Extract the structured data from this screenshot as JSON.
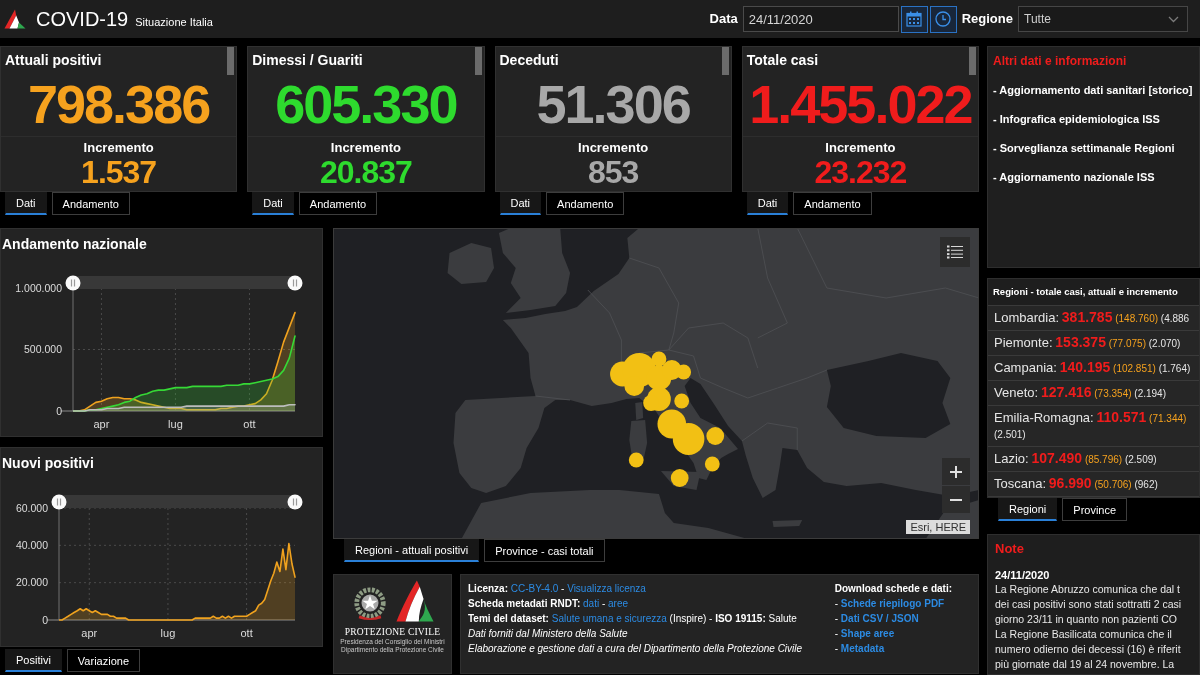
{
  "header": {
    "title": "COVID-19",
    "subtitle": "Situazione Italia",
    "date_label": "Data",
    "date_field": {
      "value": "24/11/2020"
    },
    "region_label": "Regione",
    "region_select": {
      "value": "Tutte"
    }
  },
  "summary_cards": [
    {
      "title": "Attuali positivi",
      "value": "798.386",
      "increment_label": "Incremento",
      "increment": "1.537",
      "color": "#f6a21e",
      "tabs": [
        {
          "label": "Dati",
          "selected": true
        },
        {
          "label": "Andamento",
          "selected": false
        }
      ]
    },
    {
      "title": "Dimessi / Guariti",
      "value": "605.330",
      "increment_label": "Incremento",
      "increment": "20.837",
      "color": "#2edb2e",
      "tabs": [
        {
          "label": "Dati",
          "selected": true
        },
        {
          "label": "Andamento",
          "selected": false
        }
      ]
    },
    {
      "title": "Deceduti",
      "value": "51.306",
      "increment_label": "Incremento",
      "increment": "853",
      "color": "#a8a8a8",
      "tabs": [
        {
          "label": "Dati",
          "selected": true
        },
        {
          "label": "Andamento",
          "selected": false
        }
      ]
    },
    {
      "title": "Totale casi",
      "value": "1.455.022",
      "increment_label": "Incremento",
      "increment": "23.232",
      "color": "#f01c1c",
      "tabs": [
        {
          "label": "Dati",
          "selected": true
        },
        {
          "label": "Andamento",
          "selected": false
        }
      ]
    }
  ],
  "other_info": {
    "title": "Altri dati e informazioni",
    "links": [
      "- Aggiornamento dati sanitari [storico]",
      "- Infografica epidemiologica ISS",
      "- Sorveglianza settimanale Regioni",
      "- Aggiornamento nazionale ISS"
    ]
  },
  "charts": [
    {
      "title": "Andamento nazionale",
      "range_slider": {
        "start": {
          "level": 0
        },
        "end": {
          "level": 1
        }
      },
      "chart_data": {
        "type": "area",
        "grid": true,
        "categories": [
          null,
          null,
          null,
          null,
          null,
          "apr",
          null,
          null,
          null,
          null,
          null,
          null,
          null,
          null,
          null,
          null,
          null,
          null,
          "lug",
          null,
          null,
          null,
          null,
          null,
          null,
          null,
          null,
          null,
          null,
          null,
          null,
          "ott",
          null,
          null,
          null,
          null,
          null,
          null,
          null,
          null
        ],
        "ylim": [
          0,
          1000000
        ],
        "yticks": [
          {
            "value": 0,
            "label": "0"
          },
          {
            "value": 500000,
            "label": "500.000"
          },
          {
            "value": 1000000,
            "label": "1.000.000"
          }
        ],
        "series": [
          {
            "color": "#f0a21e",
            "values": [
              0,
              0,
              10000,
              40000,
              70000,
              80000,
              100000,
              110000,
              110000,
              100000,
              100000,
              90000,
              70000,
              60000,
              50000,
              40000,
              30000,
              20000,
              20000,
              20000,
              10000,
              10000,
              10000,
              10000,
              10000,
              10000,
              20000,
              20000,
              30000,
              40000,
              40000,
              50000,
              60000,
              90000,
              140000,
              250000,
              400000,
              560000,
              680000,
              800000
            ]
          },
          {
            "color": "#36d936",
            "values": [
              0,
              0,
              0,
              10000,
              10000,
              20000,
              30000,
              40000,
              50000,
              70000,
              80000,
              110000,
              130000,
              140000,
              160000,
              170000,
              170000,
              180000,
              190000,
              190000,
              190000,
              200000,
              200000,
              200000,
              200000,
              200000,
              200000,
              210000,
              210000,
              210000,
              220000,
              220000,
              230000,
              240000,
              250000,
              260000,
              280000,
              330000,
              430000,
              610000
            ]
          },
          {
            "color": "#bdbdbd",
            "values": [
              0,
              0,
              0,
              10000,
              10000,
              10000,
              20000,
              20000,
              20000,
              30000,
              30000,
              30000,
              30000,
              30000,
              30000,
              30000,
              30000,
              30000,
              30000,
              30000,
              40000,
              40000,
              40000,
              40000,
              40000,
              40000,
              40000,
              40000,
              40000,
              40000,
              40000,
              40000,
              40000,
              40000,
              40000,
              40000,
              40000,
              40000,
              50000,
              50000
            ]
          }
        ]
      }
    },
    {
      "title": "Nuovi positivi",
      "range_slider": {
        "start": {
          "level": 0
        },
        "end": {
          "level": 1
        }
      },
      "chart_data": {
        "type": "area",
        "grid": true,
        "categories": [
          null,
          null,
          null,
          null,
          null,
          null,
          null,
          null,
          null,
          null,
          "apr",
          null,
          null,
          null,
          null,
          null,
          null,
          null,
          null,
          null,
          null,
          null,
          null,
          null,
          null,
          null,
          null,
          null,
          null,
          null,
          null,
          null,
          null,
          null,
          null,
          null,
          "lug",
          null,
          null,
          null,
          null,
          null,
          null,
          null,
          null,
          null,
          null,
          null,
          null,
          null,
          null,
          null,
          null,
          null,
          null,
          null,
          null,
          null,
          null,
          null,
          null,
          null,
          "ott",
          null,
          null,
          null,
          null,
          null,
          null,
          null,
          null,
          null,
          null,
          null,
          null,
          null,
          null,
          null,
          null
        ],
        "ylim": [
          0,
          60000
        ],
        "yticks": [
          {
            "value": 0,
            "label": "0"
          },
          {
            "value": 20000,
            "label": "20.000"
          },
          {
            "value": 40000,
            "label": "40.000"
          },
          {
            "value": 60000,
            "label": "60.000"
          }
        ],
        "series": [
          {
            "color": "#f0a21e",
            "values": [
              0,
              0,
              1000,
              2000,
              3000,
              4000,
              5000,
              6000,
              5000,
              6000,
              5000,
              4000,
              5000,
              4000,
              3000,
              3000,
              3000,
              2000,
              2000,
              1000,
              1000,
              1000,
              1000,
              0,
              0,
              0,
              0,
              0,
              0,
              0,
              0,
              0,
              0,
              0,
              0,
              0,
              0,
              0,
              0,
              0,
              0,
              0,
              0,
              0,
              0,
              1000,
              1000,
              1000,
              1000,
              1000,
              1000,
              2000,
              1000,
              1000,
              2000,
              1000,
              2000,
              1000,
              2000,
              2000,
              2000,
              2000,
              2000,
              3000,
              4000,
              5000,
              8000,
              9000,
              11000,
              16000,
              21000,
              25000,
              31000,
              26000,
              38000,
              27000,
              41000,
              30000,
              23000
            ]
          }
        ]
      }
    }
  ],
  "chart_tabs": [
    {
      "label": "Positivi",
      "selected": true
    },
    {
      "label": "Variazione",
      "selected": false
    }
  ],
  "map": {
    "attribution": "Esri, HERE",
    "tabs": [
      {
        "label": "Regioni - attuali positivi",
        "selected": true
      },
      {
        "label": "Province - casi totali",
        "selected": false
      }
    ]
  },
  "regions": {
    "title": "Regioni - totale casi, attuali e incremento",
    "rows": [
      {
        "name": "Lombardia:",
        "total": "381.785",
        "current": "(148.760)",
        "increment": "(4.886"
      },
      {
        "name": "Piemonte:",
        "total": "153.375",
        "current": "(77.075)",
        "increment": "(2.070)"
      },
      {
        "name": "Campania:",
        "total": "140.195",
        "current": "(102.851)",
        "increment": "(1.764)"
      },
      {
        "name": "Veneto:",
        "total": "127.416",
        "current": "(73.354)",
        "increment": "(2.194)"
      },
      {
        "name": "Emilia-Romagna:",
        "total": "110.571",
        "current": "(71.344)",
        "increment": "(2.501)"
      },
      {
        "name": "Lazio:",
        "total": "107.490",
        "current": "(85.796)",
        "increment": "(2.509)"
      },
      {
        "name": "Toscana:",
        "total": "96.990",
        "current": "(50.706)",
        "increment": "(962)"
      }
    ],
    "tabs": [
      {
        "label": "Regioni",
        "selected": true
      },
      {
        "label": "Province",
        "selected": false
      }
    ]
  },
  "info": {
    "logo": {
      "name": "PROTEZIONE CIVILE",
      "lines": [
        "Presidenza del Consiglio dei Ministri",
        "Dipartimento della Protezione Civile"
      ]
    },
    "lines": [
      {
        "parts": [
          {
            "kind": "label",
            "text": "Licenza:"
          },
          {
            "kind": "link",
            "text": "CC-BY-4.0"
          },
          {
            "kind": "plain",
            "text": "-"
          },
          {
            "kind": "link",
            "text": "Visualizza licenza"
          }
        ]
      },
      {
        "parts": [
          {
            "kind": "label",
            "text": "Scheda metadati RNDT:"
          },
          {
            "kind": "link",
            "text": "dati"
          },
          {
            "kind": "plain",
            "text": "-"
          },
          {
            "kind": "link",
            "text": "aree"
          }
        ]
      },
      {
        "parts": [
          {
            "kind": "label",
            "text": "Temi del dataset:"
          },
          {
            "kind": "link",
            "text": "Salute umana e sicurezza"
          },
          {
            "kind": "plain",
            "text": "(Inspire) -"
          },
          {
            "kind": "label",
            "text": "ISO 19115:"
          },
          {
            "kind": "plain",
            "text": "Salute"
          }
        ]
      },
      {
        "parts": [
          {
            "kind": "credit",
            "text": "Dati forniti dal Ministero della Salute"
          }
        ]
      },
      {
        "parts": [
          {
            "kind": "credit",
            "text": "Elaborazione e gestione dati a cura del Dipartimento della Protezione Civile"
          }
        ]
      }
    ],
    "downloads": {
      "title": "Download schede e dati:",
      "items": [
        {
          "prefix": "-",
          "text": "Schede riepilogo PDF"
        },
        {
          "prefix": "-",
          "text": "Dati CSV / JSON"
        },
        {
          "prefix": "-",
          "text": "Shape aree"
        },
        {
          "prefix": "-",
          "text": "Metadata"
        }
      ]
    }
  },
  "notes": {
    "title": "Note",
    "entries": [
      {
        "date": "24/11/2020",
        "paragraphs": [
          [
            "La Regione Abruzzo comunica che dal t",
            "dei casi positivi sono stati sottratti 2 casi",
            "giorno 23/11 in quanto non pazienti CO"
          ],
          [
            "La Regione Basilicata comunica che il",
            "numero odierno dei decessi (16) è riferit",
            "più giornate dal 19 al 24 novembre. La"
          ]
        ]
      }
    ]
  }
}
